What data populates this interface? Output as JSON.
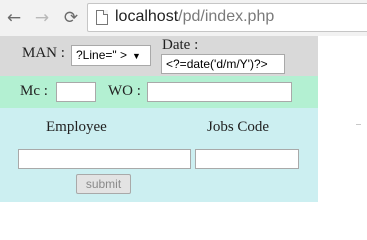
{
  "browser": {
    "back_glyph": "←",
    "forward_glyph": "→",
    "reload_glyph": "⟳",
    "url_host": "localhost",
    "url_path": "/pd/index.php"
  },
  "form": {
    "man_label": "MAN :",
    "man_select_value": "?Line=\" >",
    "date_label": "Date :",
    "date_value": "<?=date('d/m/Y')?>",
    "mc_label": "Mc :",
    "mc_value": "",
    "wo_label": "WO :",
    "wo_value": "",
    "employee_label": "Employee",
    "jobs_code_label": "Jobs Code",
    "employee_value": "",
    "jobs_code_value": "",
    "submit_label": "submit"
  },
  "colors": {
    "row1_bg": "#d9d9d9",
    "row2_bg": "#b3f0d2",
    "row3_bg": "#cceff1"
  }
}
